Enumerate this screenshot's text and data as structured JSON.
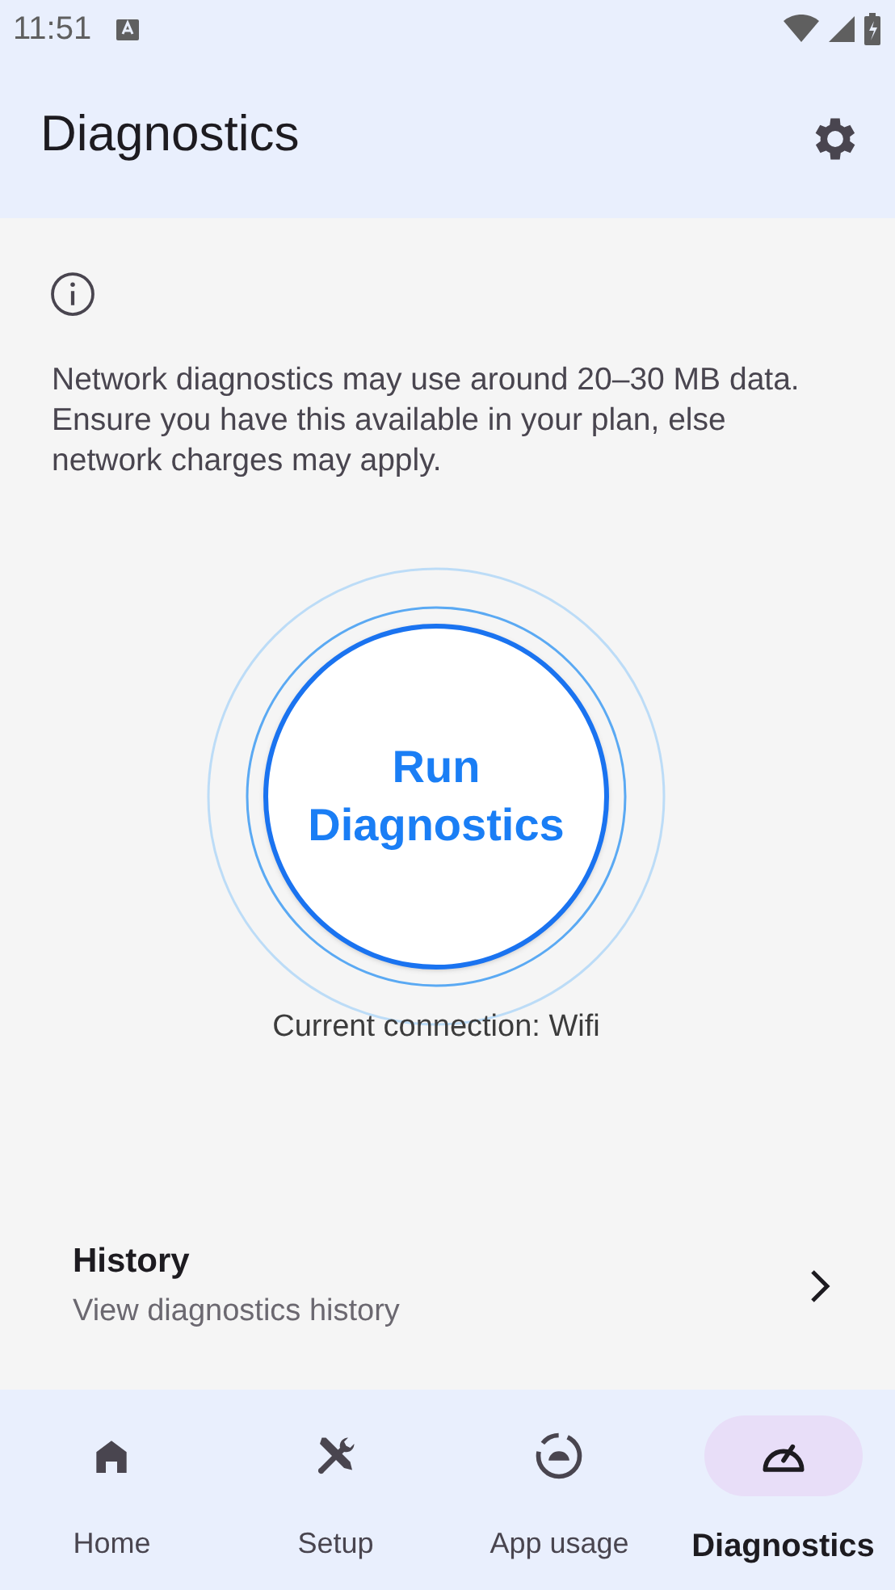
{
  "status_bar": {
    "time": "11:51"
  },
  "app_bar": {
    "title": "Diagnostics"
  },
  "notice": {
    "text": "Network diagnostics may use around 20–30 MB data. Ensure you have this available in your plan, else network charges may apply."
  },
  "run_button": {
    "label_line_1": "Run",
    "label_line_2": "Diagnostics"
  },
  "connection": {
    "text": "Current connection: Wifi"
  },
  "history": {
    "title": "History",
    "subtitle": "View diagnostics history"
  },
  "bottom_nav": [
    {
      "label": "Home",
      "selected": false
    },
    {
      "label": "Setup",
      "selected": false
    },
    {
      "label": "App usage",
      "selected": false
    },
    {
      "label": "Diagnostics",
      "selected": true
    }
  ]
}
